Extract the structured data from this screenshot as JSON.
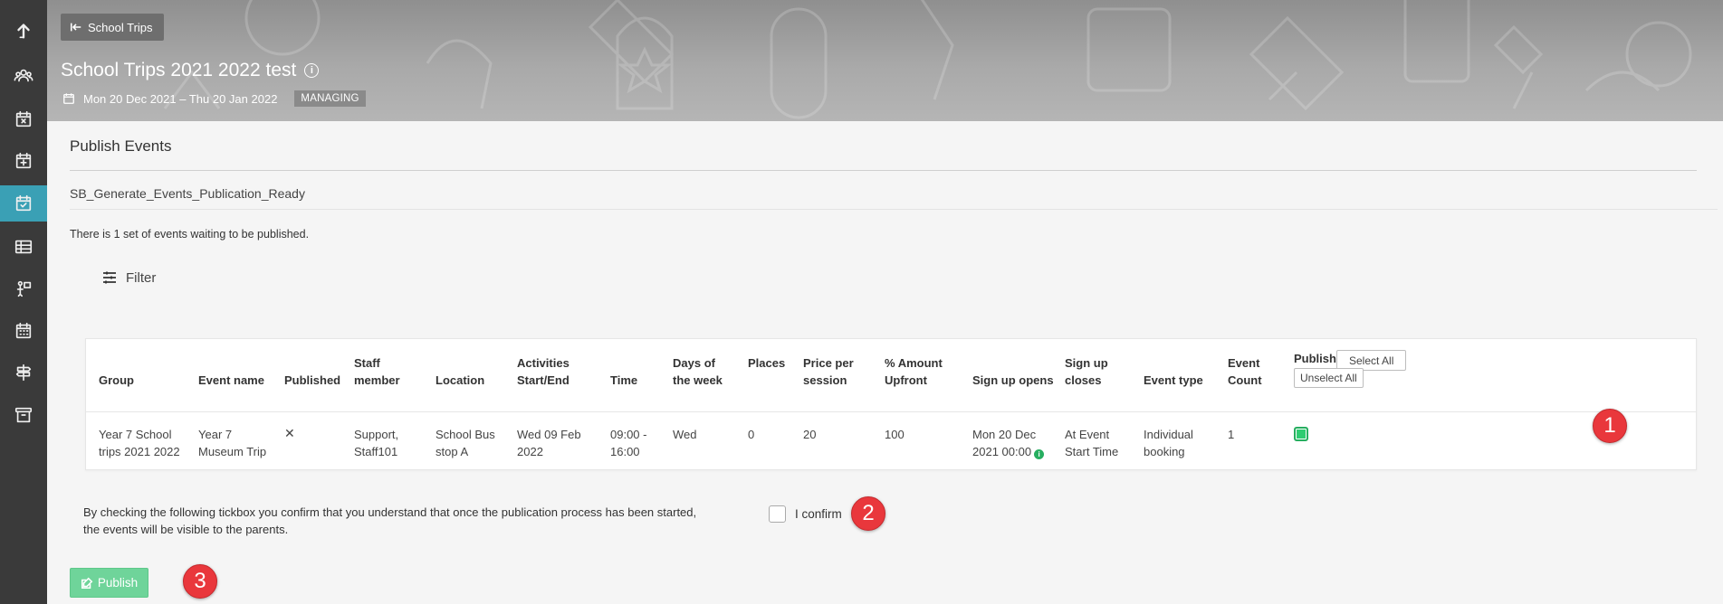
{
  "sidebar": {
    "items": [
      {
        "icon": "upload-arrow-icon"
      },
      {
        "icon": "users-icon"
      },
      {
        "icon": "calendar-x-icon"
      },
      {
        "icon": "calendar-plus-icon"
      },
      {
        "icon": "calendar-check-icon",
        "active": true
      },
      {
        "icon": "table-icon"
      },
      {
        "icon": "person-board-icon"
      },
      {
        "icon": "calendar-grid-icon"
      },
      {
        "icon": "signpost-icon"
      },
      {
        "icon": "archive-icon"
      }
    ]
  },
  "header": {
    "back_label": "School Trips",
    "title": "School Trips 2021 2022 test",
    "info_glyph": "i",
    "date_range": "Mon 20 Dec 2021 – Thu 20 Jan 2022",
    "badge": "MANAGING"
  },
  "main": {
    "section_title": "Publish Events",
    "subname": "SB_Generate_Events_Publication_Ready",
    "waiting_text": "There is 1 set of events waiting to be published.",
    "filter_label": "Filter"
  },
  "table": {
    "headers": {
      "group": "Group",
      "event_name": "Event name",
      "published": "Published",
      "staff_1": "Staff",
      "staff_2": "member",
      "location": "Location",
      "activities_1": "Activities",
      "activities_2": "Start/End",
      "time": "Time",
      "days_1": "Days of",
      "days_2": "the week",
      "places": "Places",
      "price_1": "Price per",
      "price_2": "session",
      "amount_1": "% Amount",
      "amount_2": "Upfront",
      "signup_opens": "Sign up opens",
      "signup_closes_1": "Sign up",
      "signup_closes_2": "closes",
      "event_type": "Event type",
      "count_1": "Event",
      "count_2": "Count",
      "publish": "Publish",
      "select_all": "Select All",
      "unselect_all": "Unselect All"
    },
    "row": {
      "group_1": "Year 7 School",
      "group_2": "trips 2021 2022",
      "event_1": "Year 7",
      "event_2": "Museum Trip",
      "published": "✕",
      "staff_1": "Support,",
      "staff_2": "Staff101",
      "location_1": "School Bus",
      "location_2": "stop A",
      "activities_1": "Wed 09 Feb",
      "activities_2": "2022",
      "time_1": "09:00 -",
      "time_2": "16:00",
      "days": "Wed",
      "places": "0",
      "price": "20",
      "amount": "100",
      "opens_1": "Mon 20 Dec",
      "opens_2": "2021 00:00",
      "opens_info": "i",
      "closes_1": "At Event",
      "closes_2": "Start Time",
      "type_1": "Individual",
      "type_2": "booking",
      "count": "1",
      "publish_checked": true
    }
  },
  "confirmation": {
    "disclaimer_1": "By checking the following tickbox you confirm that you understand that once the publication process has been started,",
    "disclaimer_2": "the events will be visible to the parents.",
    "confirm_label": "I confirm",
    "checked": false
  },
  "actions": {
    "publish_label": "Publish"
  },
  "markers": [
    "1",
    "2",
    "3"
  ],
  "colors": {
    "sidebar_bg": "#3a3a3a",
    "sidebar_active": "#3aa0b5",
    "publish_green": "#6fd49a",
    "checkbox_green": "#2ecc71",
    "marker_red": "#e9373c"
  }
}
